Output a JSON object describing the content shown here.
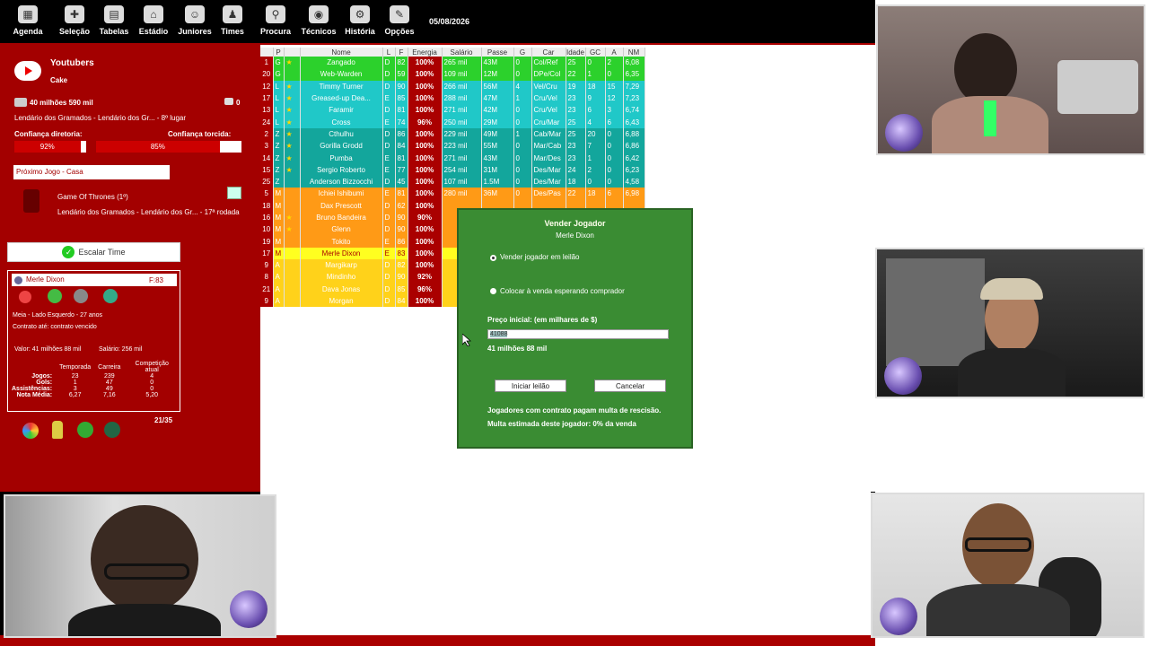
{
  "topnav": [
    {
      "label": "Agenda",
      "icon": "calendar-icon",
      "glyph": "▦"
    },
    {
      "label": "Seleção",
      "icon": "flag-icon",
      "glyph": "✚"
    },
    {
      "label": "Tabelas",
      "icon": "table-icon",
      "glyph": "▤"
    },
    {
      "label": "Estádio",
      "icon": "stadium-icon",
      "glyph": "⌂"
    },
    {
      "label": "Juniores",
      "icon": "junior-player-icon",
      "glyph": "☺"
    },
    {
      "label": "Times",
      "icon": "shirt-icon",
      "glyph": "♟"
    },
    {
      "label": "Procura",
      "icon": "search-icon",
      "glyph": "⚲"
    },
    {
      "label": "Técnicos",
      "icon": "coach-icon",
      "glyph": "◉"
    },
    {
      "label": "História",
      "icon": "history-icon",
      "glyph": "⚙"
    },
    {
      "label": "Opções",
      "icon": "options-icon",
      "glyph": "✎"
    }
  ],
  "date": "05/08/2026",
  "club": {
    "name": "Youtubers",
    "manager": "Cake",
    "money": "40 milhões 590 mil",
    "messages": "0",
    "league": "Lendário dos Gramados - Lendário dos Gr... - 8º lugar",
    "board_label": "Confiança diretoria:",
    "board_pct": 92,
    "board_text": "92%",
    "fans_label": "Confiança torcida:",
    "fans_pct": 85,
    "fans_text": "85%",
    "next_game_title": "Próximo Jogo - Casa",
    "next_opponent": "Game Of Thrones (1º)",
    "next_comp": "Lendário dos Gramados - Lendário dos Gr... - 17ª rodada",
    "escalar": "Escalar Time"
  },
  "player_card": {
    "name": "Merle Dixon",
    "rating": "F:83",
    "position": "Meia - Lado Esquerdo - 27 anos",
    "contract": "Contrato até: contrato vencido",
    "value": "Valor: 41 milhões 88 mil",
    "salary": "Salário: 256 mil",
    "cols": [
      "Temporada",
      "Carreira",
      "Competição atual"
    ],
    "rows": [
      {
        "k": "Jogos:",
        "a": "23",
        "b": "239",
        "c": "4"
      },
      {
        "k": "Gols:",
        "a": "1",
        "b": "47",
        "c": "0"
      },
      {
        "k": "Assistências:",
        "a": "3",
        "b": "49",
        "c": "0"
      },
      {
        "k": "Nota Média:",
        "a": "6,27",
        "b": "7,16",
        "c": "5,20"
      }
    ],
    "squad_count": "21/35"
  },
  "table": {
    "headers": [
      "",
      "P",
      "",
      "Nome",
      "L",
      "F",
      "Energia",
      "Salário",
      "Passe",
      "G",
      "Car",
      "Idade",
      "GC",
      "A",
      "NM"
    ],
    "colors": {
      "G": "#2cd12c",
      "L": "#20c8c8",
      "Z": "#13a69c",
      "M": "#ff9a16",
      "A": "#ffd21a"
    },
    "rows": [
      {
        "n": "1",
        "p": "G",
        "name": "Zangado",
        "l": "D",
        "f": "82",
        "e": "100%",
        "sal": "265 mil",
        "passe": "43M",
        "g": "0",
        "car": "Col/Ref",
        "age": "25",
        "gc": "0",
        "a": "2",
        "nm": "6,08",
        "star": true
      },
      {
        "n": "20",
        "p": "G",
        "name": "Web-Warden",
        "l": "D",
        "f": "59",
        "e": "100%",
        "sal": "109 mil",
        "passe": "12M",
        "g": "0",
        "car": "DPe/Col",
        "age": "22",
        "gc": "1",
        "a": "0",
        "nm": "6,35",
        "star": false
      },
      {
        "n": "12",
        "p": "L",
        "name": "Timmy Turner",
        "l": "D",
        "f": "90",
        "e": "100%",
        "sal": "266 mil",
        "passe": "56M",
        "g": "4",
        "car": "Vel/Cru",
        "age": "19",
        "gc": "18",
        "a": "15",
        "nm": "7,29",
        "star": true
      },
      {
        "n": "17",
        "p": "L",
        "name": "Greased-up Dea...",
        "l": "E",
        "f": "85",
        "e": "100%",
        "sal": "288 mil",
        "passe": "47M",
        "g": "1",
        "car": "Cru/Vel",
        "age": "23",
        "gc": "9",
        "a": "12",
        "nm": "7,23",
        "star": true
      },
      {
        "n": "13",
        "p": "L",
        "name": "Faramir",
        "l": "D",
        "f": "81",
        "e": "100%",
        "sal": "271 mil",
        "passe": "42M",
        "g": "0",
        "car": "Cru/Vel",
        "age": "23",
        "gc": "6",
        "a": "3",
        "nm": "6,74",
        "star": true
      },
      {
        "n": "24",
        "p": "L",
        "name": "Cross",
        "l": "E",
        "f": "74",
        "e": "96%",
        "sal": "250 mil",
        "passe": "29M",
        "g": "0",
        "car": "Cru/Mar",
        "age": "25",
        "gc": "4",
        "a": "6",
        "nm": "6,43",
        "star": true
      },
      {
        "n": "2",
        "p": "Z",
        "name": "Cthulhu",
        "l": "D",
        "f": "86",
        "e": "100%",
        "sal": "229 mil",
        "passe": "49M",
        "g": "1",
        "car": "Cab/Mar",
        "age": "25",
        "gc": "20",
        "a": "0",
        "nm": "6,88",
        "star": true
      },
      {
        "n": "3",
        "p": "Z",
        "name": "Gorilla Grodd",
        "l": "D",
        "f": "84",
        "e": "100%",
        "sal": "223 mil",
        "passe": "55M",
        "g": "0",
        "car": "Mar/Cab",
        "age": "23",
        "gc": "7",
        "a": "0",
        "nm": "6,86",
        "star": true
      },
      {
        "n": "14",
        "p": "Z",
        "name": "Pumba",
        "l": "E",
        "f": "81",
        "e": "100%",
        "sal": "271 mil",
        "passe": "43M",
        "g": "0",
        "car": "Mar/Des",
        "age": "23",
        "gc": "1",
        "a": "0",
        "nm": "6,42",
        "star": true
      },
      {
        "n": "15",
        "p": "Z",
        "name": "Sergio Roberto",
        "l": "E",
        "f": "77",
        "e": "100%",
        "sal": "254 mil",
        "passe": "31M",
        "g": "0",
        "car": "Des/Mar",
        "age": "24",
        "gc": "2",
        "a": "0",
        "nm": "6,23",
        "star": true
      },
      {
        "n": "25",
        "p": "Z",
        "name": "Anderson Bizzocchi",
        "l": "D",
        "f": "45",
        "e": "100%",
        "sal": "107 mil",
        "passe": "1.5M",
        "g": "0",
        "car": "Des/Mar",
        "age": "18",
        "gc": "0",
        "a": "0",
        "nm": "4,58",
        "star": false
      },
      {
        "n": "5",
        "p": "M",
        "name": "Ichiei Ishibumi",
        "l": "E",
        "f": "81",
        "e": "100%",
        "sal": "280 mil",
        "passe": "36M",
        "g": "0",
        "car": "Des/Pas",
        "age": "22",
        "gc": "18",
        "a": "6",
        "nm": "6,98",
        "star": false
      },
      {
        "n": "18",
        "p": "M",
        "name": "Dax Prescott",
        "l": "D",
        "f": "62",
        "e": "100%",
        "sal": "",
        "passe": "",
        "g": "",
        "car": "",
        "age": "",
        "gc": "",
        "a": "",
        "nm": "",
        "star": false
      },
      {
        "n": "16",
        "p": "M",
        "name": "Bruno Bandeira",
        "l": "D",
        "f": "90",
        "e": "90%",
        "sal": "",
        "passe": "",
        "g": "",
        "car": "",
        "age": "",
        "gc": "",
        "a": "",
        "nm": "",
        "star": true
      },
      {
        "n": "10",
        "p": "M",
        "name": "Glenn",
        "l": "D",
        "f": "90",
        "e": "100%",
        "sal": "",
        "passe": "",
        "g": "",
        "car": "",
        "age": "",
        "gc": "",
        "a": "",
        "nm": "",
        "star": true
      },
      {
        "n": "19",
        "p": "M",
        "name": "Tokito",
        "l": "E",
        "f": "86",
        "e": "100%",
        "sal": "",
        "passe": "",
        "g": "",
        "car": "",
        "age": "",
        "gc": "",
        "a": "",
        "nm": "",
        "star": false
      },
      {
        "n": "17",
        "p": "M",
        "name": "Merle Dixon",
        "l": "E",
        "f": "83",
        "e": "100%",
        "sal": "",
        "passe": "",
        "g": "",
        "car": "",
        "age": "",
        "gc": "",
        "a": "",
        "nm": "",
        "star": false,
        "selected": true
      },
      {
        "n": "9",
        "p": "A",
        "name": "Margikarp",
        "l": "D",
        "f": "82",
        "e": "100%",
        "sal": "",
        "passe": "",
        "g": "",
        "car": "",
        "age": "",
        "gc": "",
        "a": "",
        "nm": "",
        "star": false
      },
      {
        "n": "8",
        "p": "A",
        "name": "Mindinho",
        "l": "D",
        "f": "90",
        "e": "92%",
        "sal": "",
        "passe": "",
        "g": "",
        "car": "",
        "age": "",
        "gc": "",
        "a": "",
        "nm": "",
        "star": false
      },
      {
        "n": "21",
        "p": "A",
        "name": "Dava Jonas",
        "l": "D",
        "f": "85",
        "e": "96%",
        "sal": "",
        "passe": "",
        "g": "",
        "car": "",
        "age": "",
        "gc": "",
        "a": "",
        "nm": "",
        "star": false
      },
      {
        "n": "9",
        "p": "A",
        "name": "Morgan",
        "l": "D",
        "f": "84",
        "e": "100%",
        "sal": "",
        "passe": "",
        "g": "",
        "car": "",
        "age": "",
        "gc": "",
        "a": "",
        "nm": "",
        "star": false
      }
    ]
  },
  "dialog": {
    "title": "Vender Jogador",
    "player": "Merle Dixon",
    "opt1": "Vender jogador em leilão",
    "opt2": "Colocar à venda esperando comprador",
    "price_label": "Preço inicial: (em milhares de $)",
    "price_value": "41088",
    "price_text": "41 milhões 88 mil",
    "btn_start": "Iniciar leilão",
    "btn_cancel": "Cancelar",
    "note1": "Jogadores com contrato pagam multa de rescisão.",
    "note2": "Multa estimada deste jogador: 0% da venda"
  }
}
